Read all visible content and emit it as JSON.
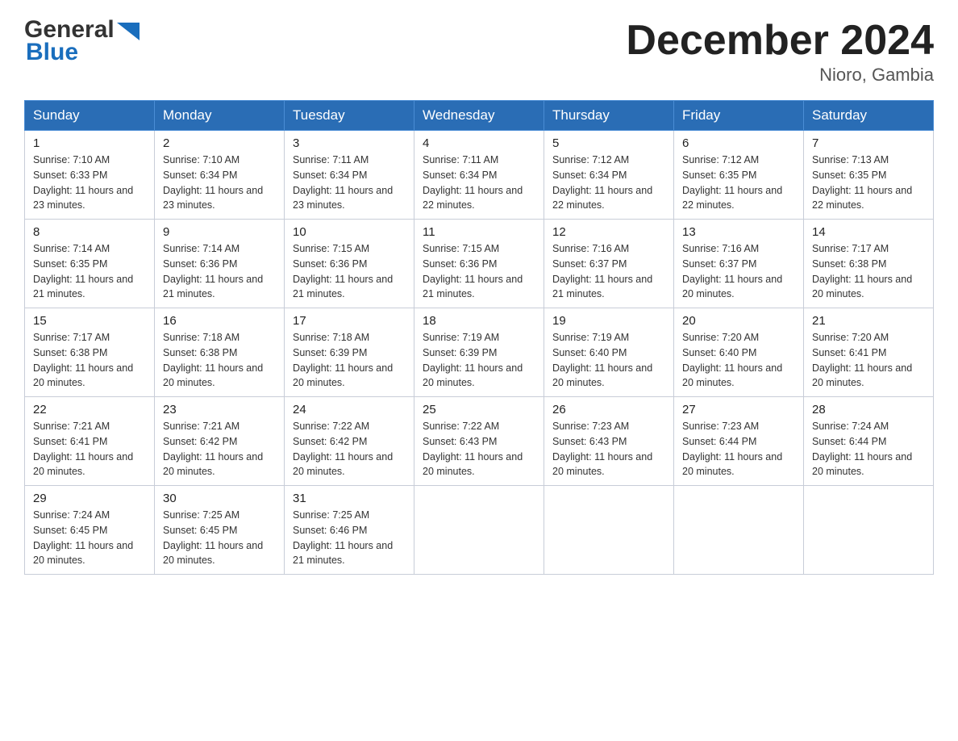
{
  "header": {
    "logo_general": "General",
    "logo_blue": "Blue",
    "title": "December 2024",
    "subtitle": "Nioro, Gambia"
  },
  "calendar": {
    "days_of_week": [
      "Sunday",
      "Monday",
      "Tuesday",
      "Wednesday",
      "Thursday",
      "Friday",
      "Saturday"
    ],
    "weeks": [
      [
        {
          "day": "1",
          "sunrise": "Sunrise: 7:10 AM",
          "sunset": "Sunset: 6:33 PM",
          "daylight": "Daylight: 11 hours and 23 minutes."
        },
        {
          "day": "2",
          "sunrise": "Sunrise: 7:10 AM",
          "sunset": "Sunset: 6:34 PM",
          "daylight": "Daylight: 11 hours and 23 minutes."
        },
        {
          "day": "3",
          "sunrise": "Sunrise: 7:11 AM",
          "sunset": "Sunset: 6:34 PM",
          "daylight": "Daylight: 11 hours and 23 minutes."
        },
        {
          "day": "4",
          "sunrise": "Sunrise: 7:11 AM",
          "sunset": "Sunset: 6:34 PM",
          "daylight": "Daylight: 11 hours and 22 minutes."
        },
        {
          "day": "5",
          "sunrise": "Sunrise: 7:12 AM",
          "sunset": "Sunset: 6:34 PM",
          "daylight": "Daylight: 11 hours and 22 minutes."
        },
        {
          "day": "6",
          "sunrise": "Sunrise: 7:12 AM",
          "sunset": "Sunset: 6:35 PM",
          "daylight": "Daylight: 11 hours and 22 minutes."
        },
        {
          "day": "7",
          "sunrise": "Sunrise: 7:13 AM",
          "sunset": "Sunset: 6:35 PM",
          "daylight": "Daylight: 11 hours and 22 minutes."
        }
      ],
      [
        {
          "day": "8",
          "sunrise": "Sunrise: 7:14 AM",
          "sunset": "Sunset: 6:35 PM",
          "daylight": "Daylight: 11 hours and 21 minutes."
        },
        {
          "day": "9",
          "sunrise": "Sunrise: 7:14 AM",
          "sunset": "Sunset: 6:36 PM",
          "daylight": "Daylight: 11 hours and 21 minutes."
        },
        {
          "day": "10",
          "sunrise": "Sunrise: 7:15 AM",
          "sunset": "Sunset: 6:36 PM",
          "daylight": "Daylight: 11 hours and 21 minutes."
        },
        {
          "day": "11",
          "sunrise": "Sunrise: 7:15 AM",
          "sunset": "Sunset: 6:36 PM",
          "daylight": "Daylight: 11 hours and 21 minutes."
        },
        {
          "day": "12",
          "sunrise": "Sunrise: 7:16 AM",
          "sunset": "Sunset: 6:37 PM",
          "daylight": "Daylight: 11 hours and 21 minutes."
        },
        {
          "day": "13",
          "sunrise": "Sunrise: 7:16 AM",
          "sunset": "Sunset: 6:37 PM",
          "daylight": "Daylight: 11 hours and 20 minutes."
        },
        {
          "day": "14",
          "sunrise": "Sunrise: 7:17 AM",
          "sunset": "Sunset: 6:38 PM",
          "daylight": "Daylight: 11 hours and 20 minutes."
        }
      ],
      [
        {
          "day": "15",
          "sunrise": "Sunrise: 7:17 AM",
          "sunset": "Sunset: 6:38 PM",
          "daylight": "Daylight: 11 hours and 20 minutes."
        },
        {
          "day": "16",
          "sunrise": "Sunrise: 7:18 AM",
          "sunset": "Sunset: 6:38 PM",
          "daylight": "Daylight: 11 hours and 20 minutes."
        },
        {
          "day": "17",
          "sunrise": "Sunrise: 7:18 AM",
          "sunset": "Sunset: 6:39 PM",
          "daylight": "Daylight: 11 hours and 20 minutes."
        },
        {
          "day": "18",
          "sunrise": "Sunrise: 7:19 AM",
          "sunset": "Sunset: 6:39 PM",
          "daylight": "Daylight: 11 hours and 20 minutes."
        },
        {
          "day": "19",
          "sunrise": "Sunrise: 7:19 AM",
          "sunset": "Sunset: 6:40 PM",
          "daylight": "Daylight: 11 hours and 20 minutes."
        },
        {
          "day": "20",
          "sunrise": "Sunrise: 7:20 AM",
          "sunset": "Sunset: 6:40 PM",
          "daylight": "Daylight: 11 hours and 20 minutes."
        },
        {
          "day": "21",
          "sunrise": "Sunrise: 7:20 AM",
          "sunset": "Sunset: 6:41 PM",
          "daylight": "Daylight: 11 hours and 20 minutes."
        }
      ],
      [
        {
          "day": "22",
          "sunrise": "Sunrise: 7:21 AM",
          "sunset": "Sunset: 6:41 PM",
          "daylight": "Daylight: 11 hours and 20 minutes."
        },
        {
          "day": "23",
          "sunrise": "Sunrise: 7:21 AM",
          "sunset": "Sunset: 6:42 PM",
          "daylight": "Daylight: 11 hours and 20 minutes."
        },
        {
          "day": "24",
          "sunrise": "Sunrise: 7:22 AM",
          "sunset": "Sunset: 6:42 PM",
          "daylight": "Daylight: 11 hours and 20 minutes."
        },
        {
          "day": "25",
          "sunrise": "Sunrise: 7:22 AM",
          "sunset": "Sunset: 6:43 PM",
          "daylight": "Daylight: 11 hours and 20 minutes."
        },
        {
          "day": "26",
          "sunrise": "Sunrise: 7:23 AM",
          "sunset": "Sunset: 6:43 PM",
          "daylight": "Daylight: 11 hours and 20 minutes."
        },
        {
          "day": "27",
          "sunrise": "Sunrise: 7:23 AM",
          "sunset": "Sunset: 6:44 PM",
          "daylight": "Daylight: 11 hours and 20 minutes."
        },
        {
          "day": "28",
          "sunrise": "Sunrise: 7:24 AM",
          "sunset": "Sunset: 6:44 PM",
          "daylight": "Daylight: 11 hours and 20 minutes."
        }
      ],
      [
        {
          "day": "29",
          "sunrise": "Sunrise: 7:24 AM",
          "sunset": "Sunset: 6:45 PM",
          "daylight": "Daylight: 11 hours and 20 minutes."
        },
        {
          "day": "30",
          "sunrise": "Sunrise: 7:25 AM",
          "sunset": "Sunset: 6:45 PM",
          "daylight": "Daylight: 11 hours and 20 minutes."
        },
        {
          "day": "31",
          "sunrise": "Sunrise: 7:25 AM",
          "sunset": "Sunset: 6:46 PM",
          "daylight": "Daylight: 11 hours and 21 minutes."
        },
        null,
        null,
        null,
        null
      ]
    ]
  }
}
